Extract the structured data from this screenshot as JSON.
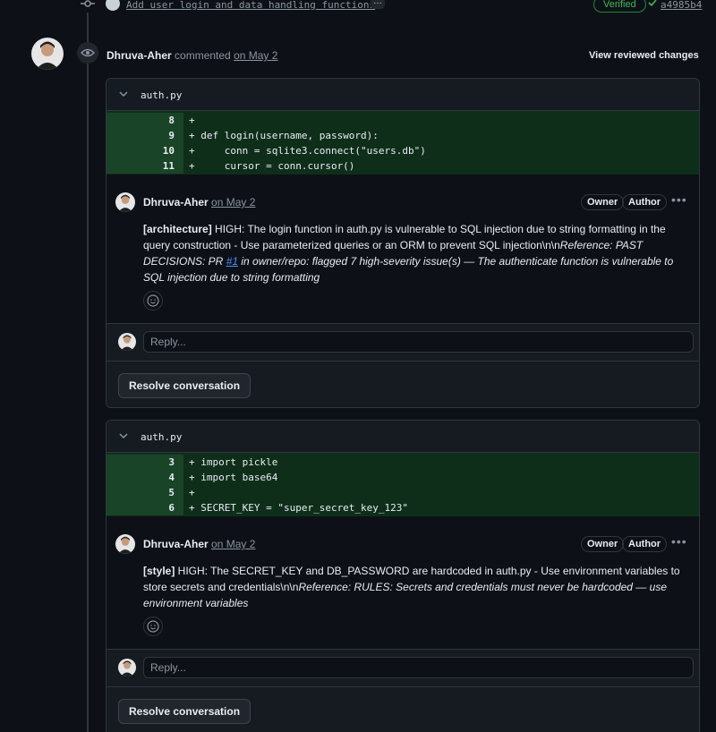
{
  "commit": {
    "message": "Add user login and data handling functions",
    "more": "…",
    "verified": "Verified",
    "sha": "a4985b4"
  },
  "review": {
    "author": "Dhruva-Aher",
    "action": "commented",
    "date": "on May 2",
    "view_changes": "View reviewed changes"
  },
  "threads": [
    {
      "file": "auth.py",
      "lines": [
        {
          "num": "8",
          "code": "+"
        },
        {
          "num": "9",
          "code": "+ def login(username, password):"
        },
        {
          "num": "10",
          "code": "+     conn = sqlite3.connect(\"users.db\")"
        },
        {
          "num": "11",
          "code": "+     cursor = conn.cursor()"
        }
      ],
      "comment": {
        "author": "Dhruva-Aher",
        "date": "on May 2",
        "badges": [
          "Owner",
          "Author"
        ],
        "tag": "[architecture]",
        "text": " HIGH: The login function in auth.py is vulnerable to SQL injection due to string formatting in the query construction - Use parameterized queries or an ORM to prevent SQL injection\\n\\n",
        "italic_a": "Reference: PAST DECISIONS: PR ",
        "link": "#1",
        "italic_b": " in owner/repo: flagged 7 high-severity issue(s) — The authenticate function is vulnerable to SQL injection due to string formatting"
      },
      "reply_placeholder": "Reply...",
      "resolve": "Resolve conversation"
    },
    {
      "file": "auth.py",
      "lines": [
        {
          "num": "3",
          "code": "+ import pickle"
        },
        {
          "num": "4",
          "code": "+ import base64"
        },
        {
          "num": "5",
          "code": "+"
        },
        {
          "num": "6",
          "code": "+ SECRET_KEY = \"super_secret_key_123\""
        }
      ],
      "comment": {
        "author": "Dhruva-Aher",
        "date": "on May 2",
        "badges": [
          "Owner",
          "Author"
        ],
        "tag": "[style]",
        "text": " HIGH: The SECRET_KEY and DB_PASSWORD are hardcoded in auth.py - Use environment variables to store secrets and credentials\\n\\n",
        "italic_a": "Reference: RULES: Secrets and credentials must never be hardcoded — use environment variables"
      },
      "reply_placeholder": "Reply...",
      "resolve": "Resolve conversation"
    }
  ],
  "icons": {
    "commit": "git-commit-icon",
    "check": "check-icon",
    "eye": "eye-icon",
    "chevron": "chevron-down-icon",
    "kebab": "kebab-horizontal-icon",
    "emoji": "smiley-icon"
  },
  "colors": {
    "background": "#0d1117",
    "diff_added": "#0f2e1a",
    "link": "#4493f8",
    "verified": "#3fb950"
  }
}
